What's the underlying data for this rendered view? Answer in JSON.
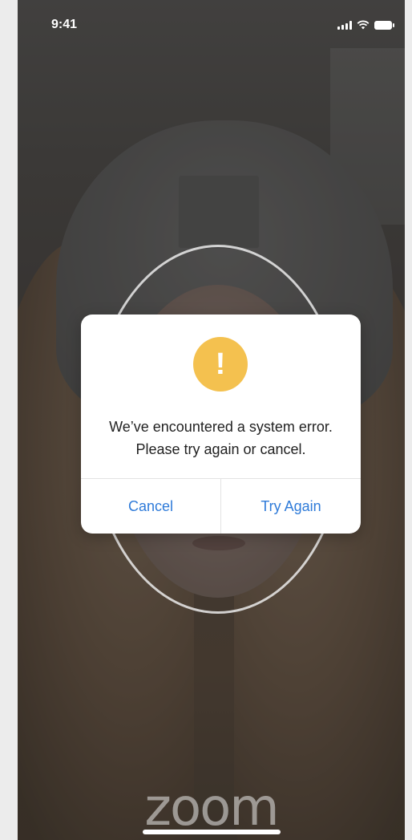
{
  "status_bar": {
    "time": "9:41",
    "icons": [
      "signal-icon",
      "wifi-icon",
      "battery-icon"
    ]
  },
  "dialog": {
    "icon": "warning-icon",
    "icon_glyph": "!",
    "icon_color": "#f4c14f",
    "message": "We’ve encountered a system error.  Please try again or cancel.",
    "buttons": {
      "cancel_label": "Cancel",
      "retry_label": "Try Again"
    },
    "button_color": "#2f7bd9"
  },
  "logo": {
    "text": "zoom"
  }
}
